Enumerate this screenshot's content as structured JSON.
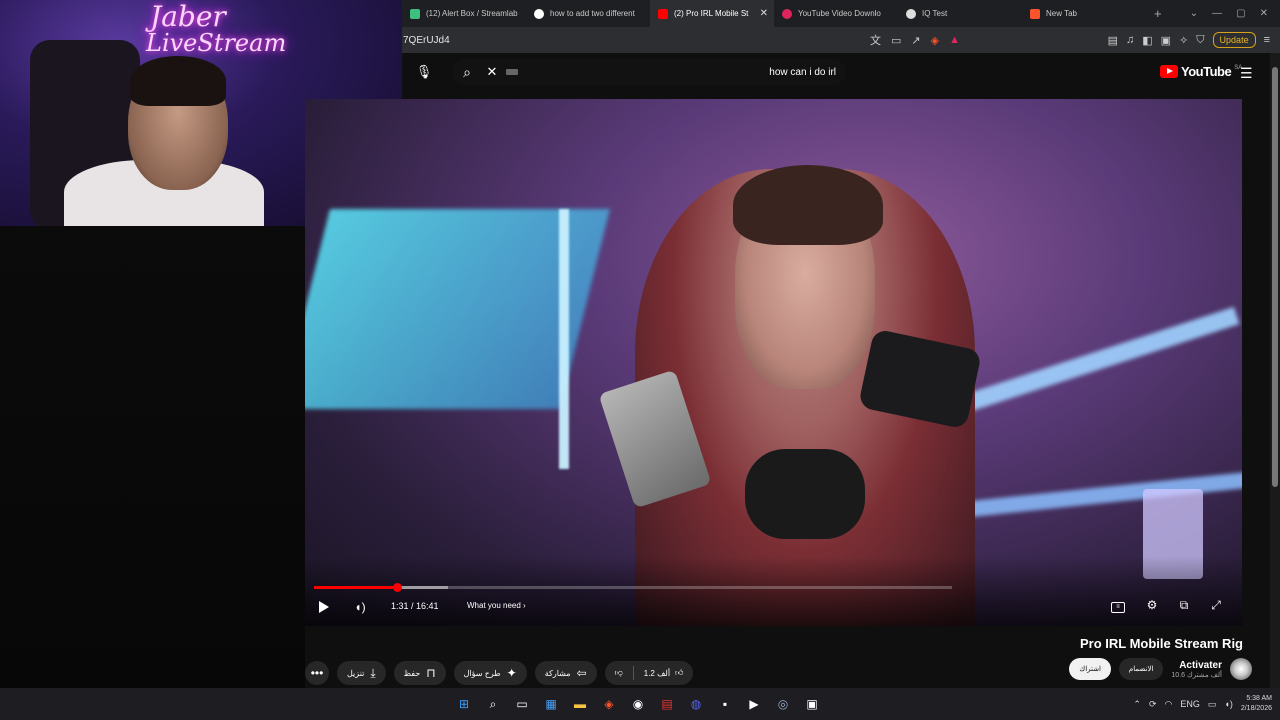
{
  "browser": {
    "tabs": [
      {
        "label": "(12) Alert Box / Streamlab",
        "color": "#3fbf7f",
        "active": false
      },
      {
        "label": "how to add two different",
        "color": "#ffffff",
        "active": false
      },
      {
        "label": "(2) Pro IRL Mobile St",
        "color": "#ff0000",
        "active": true
      },
      {
        "label": "YouTube Video Downlo",
        "color": "#e0245e",
        "active": false
      },
      {
        "label": "IQ Test",
        "color": "#dddddd",
        "active": false
      },
      {
        "label": "New Tab",
        "color": "#fb542b",
        "active": false
      }
    ],
    "new_tab_symbol": "+",
    "url": "7QErUJd4",
    "update_label": "Update"
  },
  "webcam": {
    "neon_line1": "Jaber",
    "neon_line2": "LiveStream"
  },
  "youtube": {
    "search_query": "how can i do irl",
    "logo_text": "YouTube",
    "country_code": "SA"
  },
  "player": {
    "time": "1:31 / 16:41",
    "chapter": "What you need",
    "chapter_chevron": "›",
    "progress_fraction": 0.13,
    "buffer_fraction": 0.21
  },
  "video": {
    "title": "Pro IRL Mobile Stream Rig"
  },
  "actions": {
    "like_count": "1.2 ألف",
    "share_label": "مشاركة",
    "ask_label": "طرح سؤال",
    "save_label": "حفظ",
    "download_label": "تنزيل"
  },
  "channel": {
    "name": "Activater",
    "subscribers": "10.6 ألف مشترك",
    "join_label": "الانضمام",
    "subscribe_label": "اشتراك"
  },
  "taskbar": {
    "language": "ENG",
    "time": "5:38 AM",
    "date": "2/18/2026"
  }
}
